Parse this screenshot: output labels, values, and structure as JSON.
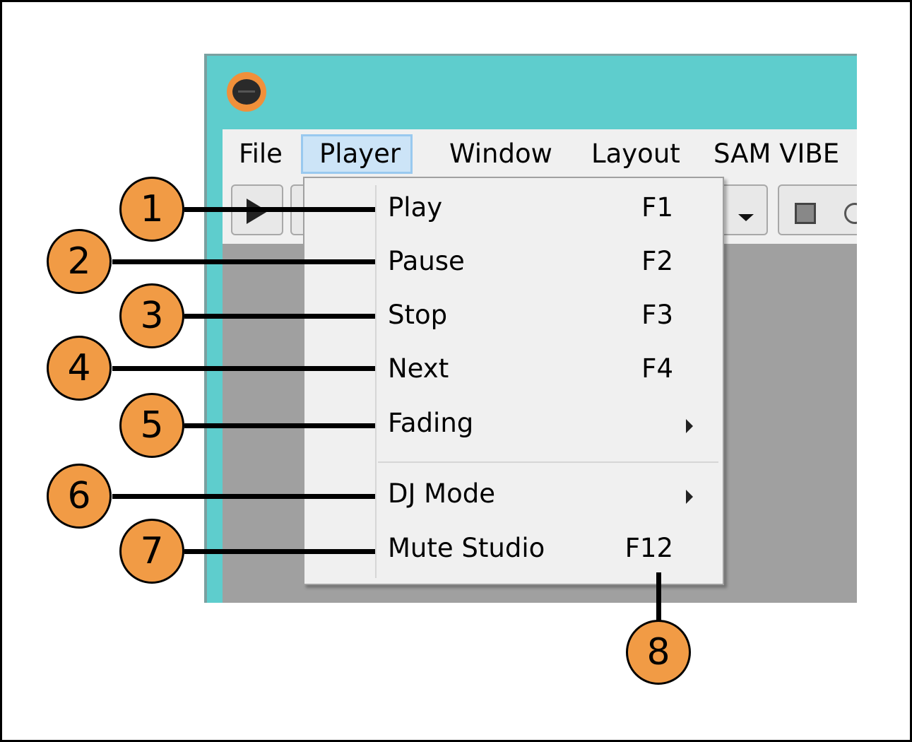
{
  "menubar": {
    "items": [
      {
        "label": "File"
      },
      {
        "label": "Player"
      },
      {
        "label": "Window"
      },
      {
        "label": "Layout"
      },
      {
        "label": "SAM VIBE"
      }
    ],
    "active": "Player"
  },
  "player_menu": {
    "items": [
      {
        "label": "Play",
        "shortcut": "F1"
      },
      {
        "label": "Pause",
        "shortcut": "F2"
      },
      {
        "label": "Stop",
        "shortcut": "F3"
      },
      {
        "label": "Next",
        "shortcut": "F4"
      },
      {
        "label": "Fading",
        "shortcut": "",
        "submenu": true
      },
      {
        "label": "DJ Mode",
        "shortcut": "",
        "submenu": true
      },
      {
        "label": "Mute Studio",
        "shortcut": "F12"
      }
    ]
  },
  "callouts": [
    "1",
    "2",
    "3",
    "4",
    "5",
    "6",
    "7",
    "8"
  ],
  "colors": {
    "title_bar": "#5ecdcd",
    "callout_fill": "#f19b45",
    "menu_highlight": "#cce4f7",
    "menu_bg": "#f0f0f0",
    "content_bg": "#a0a0a0"
  },
  "icons": {
    "app": "sam-broadcaster-logo-icon",
    "toolbar": [
      "play-icon",
      "dropdown-arrow-icon",
      "stop-icon",
      "circle-icon"
    ],
    "submenu": "chevron-right-icon"
  }
}
